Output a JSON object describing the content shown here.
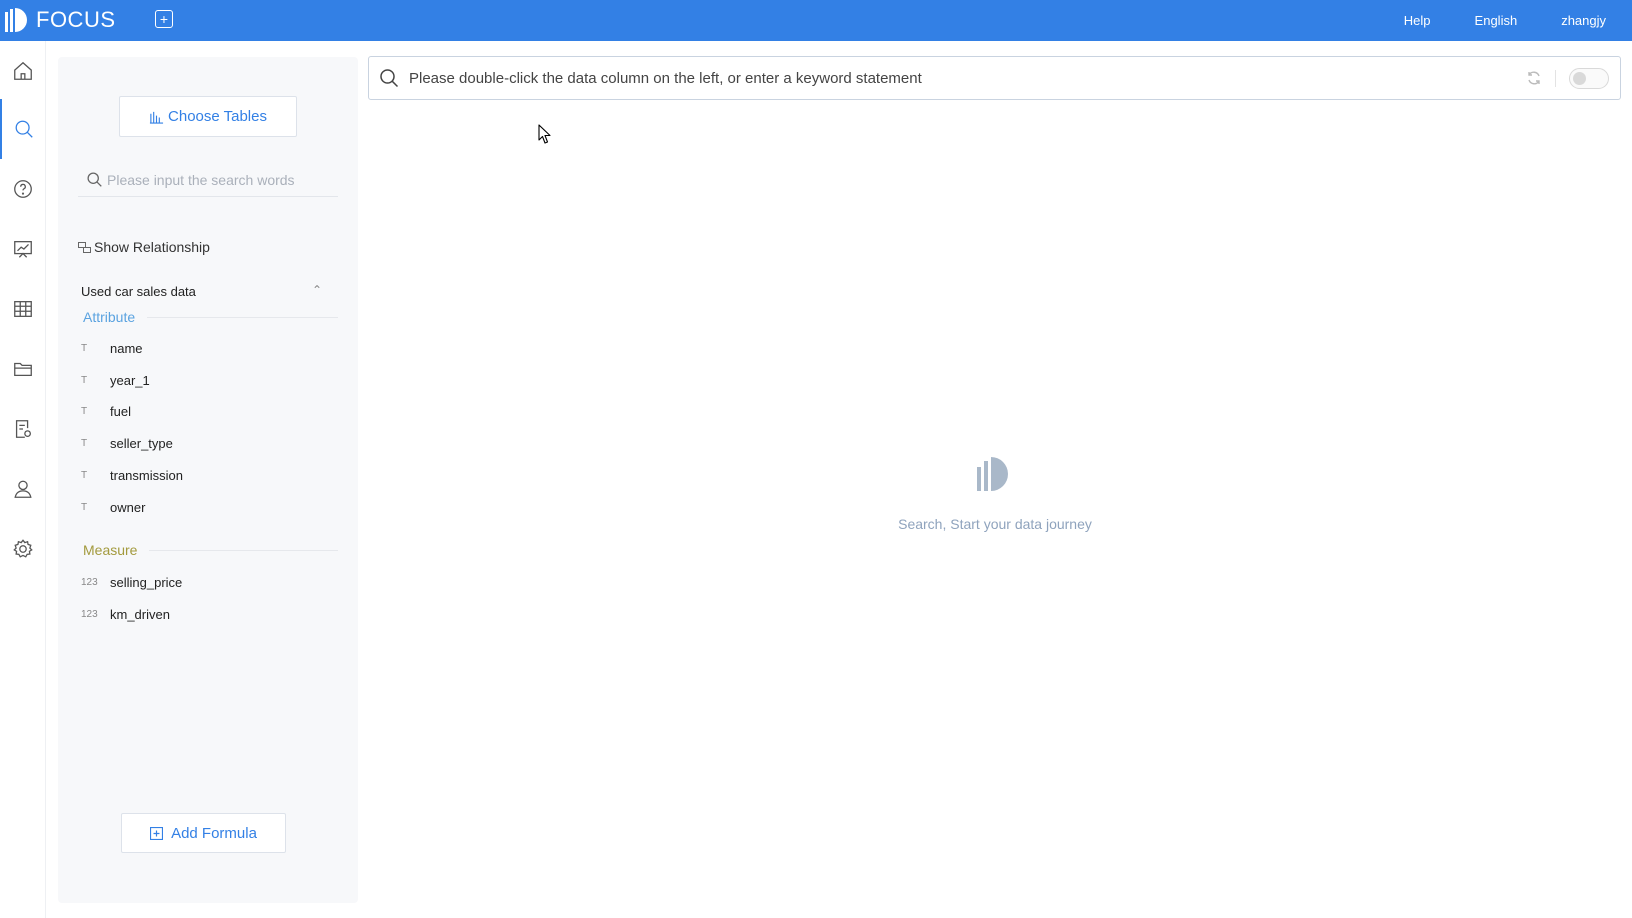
{
  "app": {
    "name": "FOCUS",
    "new_tab_icon": "plus-square-icon"
  },
  "topbar": {
    "links": [
      "Help",
      "English",
      "zhangjy"
    ]
  },
  "nav": {
    "items": [
      {
        "name": "home-icon",
        "active": false
      },
      {
        "name": "search-icon",
        "active": true
      },
      {
        "name": "question-icon",
        "active": false
      },
      {
        "name": "presentation-icon",
        "active": false
      },
      {
        "name": "table-icon",
        "active": false
      },
      {
        "name": "folder-icon",
        "active": false
      },
      {
        "name": "report-settings-icon",
        "active": false
      },
      {
        "name": "user-icon",
        "active": false
      },
      {
        "name": "gear-icon",
        "active": false
      }
    ]
  },
  "sidepanel": {
    "choose_tables_label": "Choose Tables",
    "search_placeholder": "Please input the search words",
    "show_relationship_label": "Show Relationship",
    "table_name": "Used car sales data",
    "attribute_title": "Attribute",
    "measure_title": "Measure",
    "attributes": [
      {
        "type": "T",
        "name": "name"
      },
      {
        "type": "T",
        "name": "year_1"
      },
      {
        "type": "T",
        "name": "fuel"
      },
      {
        "type": "T",
        "name": "seller_type"
      },
      {
        "type": "T",
        "name": "transmission"
      },
      {
        "type": "T",
        "name": "owner"
      }
    ],
    "measures": [
      {
        "type": "123",
        "name": "selling_price"
      },
      {
        "type": "123",
        "name": "km_driven"
      }
    ],
    "add_formula_label": "Add Formula"
  },
  "main": {
    "search_placeholder": "Please double-click the data column on the left, or enter a keyword statement",
    "empty_text": "Search, Start your data journey"
  },
  "colors": {
    "brand": "#3380e5",
    "attribute": "#5ba3e0",
    "measure": "#a39a3d"
  }
}
